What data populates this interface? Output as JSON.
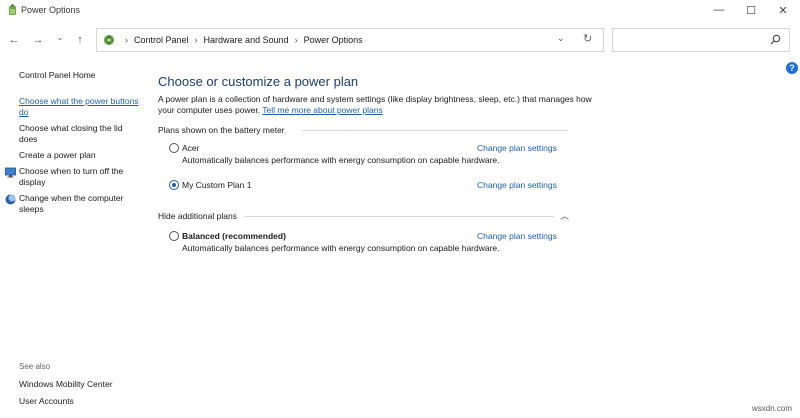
{
  "window": {
    "title": "Power Options",
    "minimize_glyph": "—",
    "maximize_glyph": "☐",
    "close_glyph": "✕"
  },
  "nav": {
    "back_glyph": "←",
    "forward_glyph": "→",
    "recent_glyph": "⌄",
    "up_glyph": "↑"
  },
  "address": {
    "crumbs": [
      "Control Panel",
      "Hardware and Sound",
      "Power Options"
    ],
    "separator": "›",
    "dropdown_glyph": "⌄",
    "refresh_glyph": "↻"
  },
  "search": {
    "placeholder": ""
  },
  "help": {
    "glyph": "?"
  },
  "left_pane": {
    "home": "Control Panel Home",
    "links": [
      {
        "label": "Choose what the power buttons do",
        "active": true,
        "icon": ""
      },
      {
        "label": "Choose what closing the lid does",
        "active": false,
        "icon": ""
      },
      {
        "label": "Create a power plan",
        "active": false,
        "icon": ""
      },
      {
        "label": "Choose when to turn off the display",
        "active": false,
        "icon": "monitor-icon"
      },
      {
        "label": "Change when the computer sleeps",
        "active": false,
        "icon": "moon-icon"
      }
    ],
    "see_also_title": "See also",
    "see_also": [
      "Windows Mobility Center",
      "User Accounts"
    ]
  },
  "main": {
    "title": "Choose or customize a power plan",
    "description": "A power plan is a collection of hardware and system settings (like display brightness, sleep, etc.) that manages how your computer uses power.",
    "description_link": "Tell me more about power plans",
    "section_battery": "Plans shown on the battery meter",
    "section_hidden": "Hide additional plans",
    "plans": [
      {
        "name": "Acer",
        "description": "Automatically balances performance with energy consumption on capable hardware.",
        "selected": false,
        "link": "Change plan settings"
      },
      {
        "name": "My Custom Plan 1",
        "description": "",
        "selected": true,
        "link": "Change plan settings"
      },
      {
        "name": "Balanced (recommended)",
        "description": "Automatically balances performance with energy consumption on capable hardware.",
        "selected": false,
        "link": "Change plan settings"
      }
    ],
    "collapse_glyph": "︿"
  },
  "watermark": "wsxdn.com",
  "colors": {
    "link": "#1e5fb4",
    "heading": "#1c3d6e",
    "help": "#1e6fd9"
  }
}
